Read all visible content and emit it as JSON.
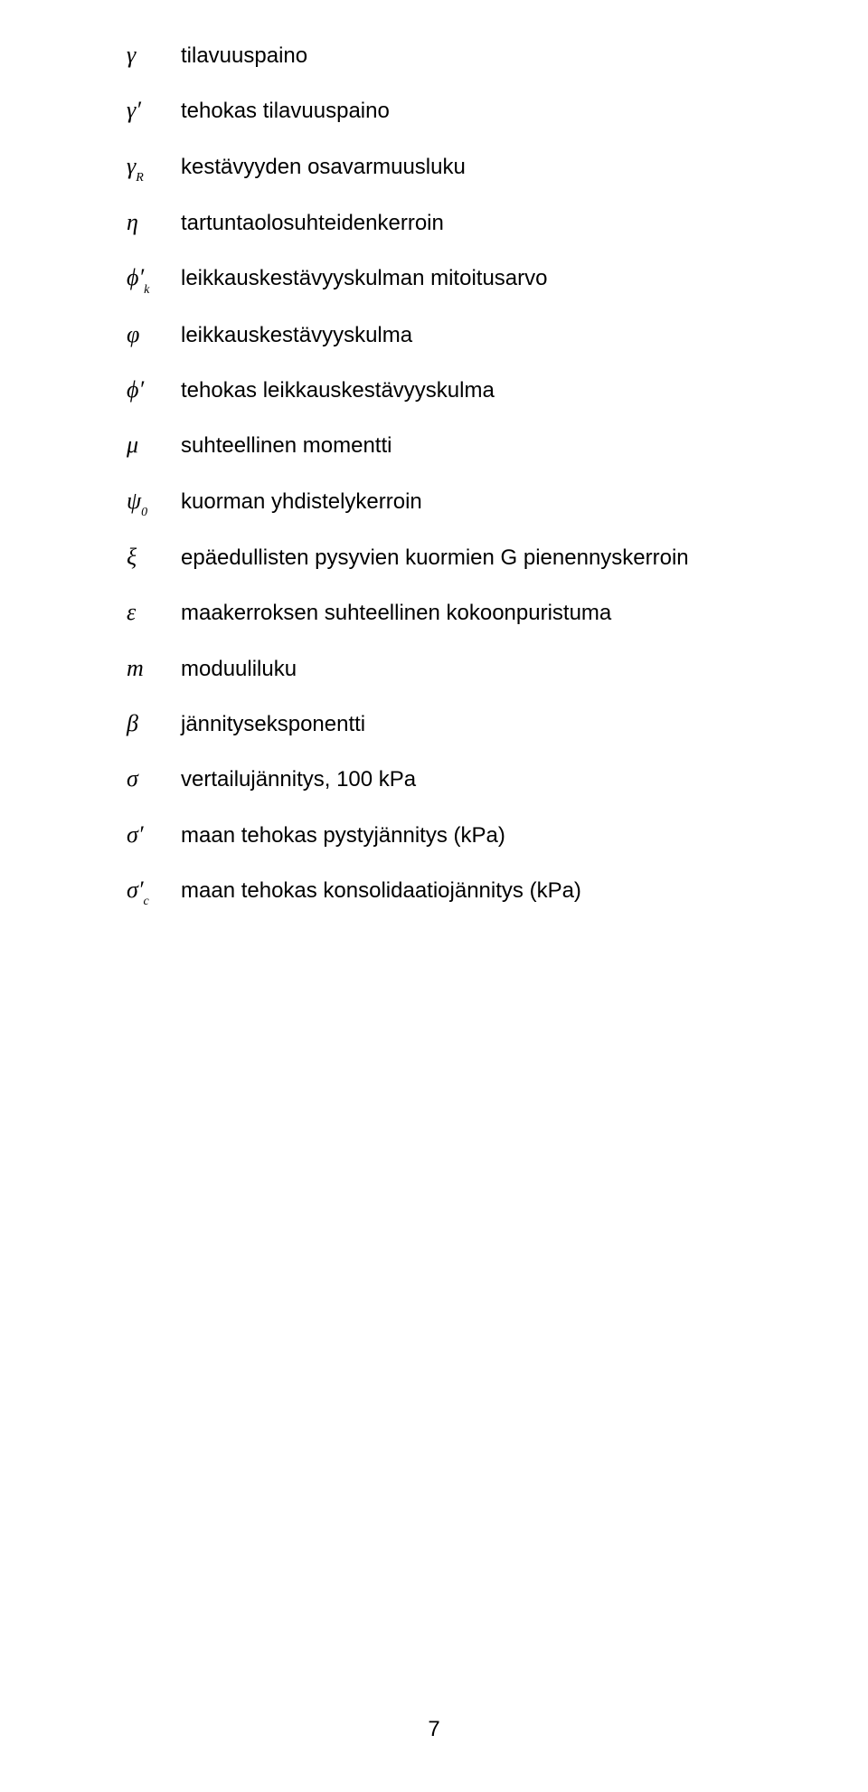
{
  "rows": [
    {
      "sym": "γ",
      "desc": "tilavuuspaino"
    },
    {
      "sym": "γ′",
      "desc": "tehokas tilavuuspaino"
    },
    {
      "sym": "γ<sub>R</sub>",
      "desc": "kestävyyden osavarmuusluku"
    },
    {
      "sym": "η",
      "desc": "tartuntaolosuhteidenkerroin"
    },
    {
      "sym": "ϕ′<sub>k</sub>",
      "desc": "leikkauskestävyyskulman mitoitusarvo"
    },
    {
      "sym": "φ",
      "desc": "leikkauskestävyyskulma"
    },
    {
      "sym": "ϕ′",
      "desc": "tehokas leikkauskestävyyskulma"
    },
    {
      "sym": "μ",
      "desc": "suhteellinen momentti"
    },
    {
      "sym": "ψ<sub>0</sub>",
      "desc": "kuorman yhdistelykerroin"
    },
    {
      "sym": "ξ",
      "desc": "epäedullisten pysyvien kuormien G pienennyskerroin"
    },
    {
      "sym": "ε",
      "desc": "maakerroksen suhteellinen kokoonpuristuma"
    },
    {
      "sym": "m",
      "desc": "moduuliluku"
    },
    {
      "sym": "β",
      "desc": "jännityseksponentti"
    },
    {
      "sym": "σ",
      "desc": "vertailujännitys, 100 kPa"
    },
    {
      "sym": "σ′",
      "desc": "maan tehokas pystyjännitys (kPa)"
    },
    {
      "sym": "σ′<sub>c</sub>",
      "desc": "maan tehokas konsolidaatiojännitys (kPa)"
    }
  ],
  "page_number": "7"
}
